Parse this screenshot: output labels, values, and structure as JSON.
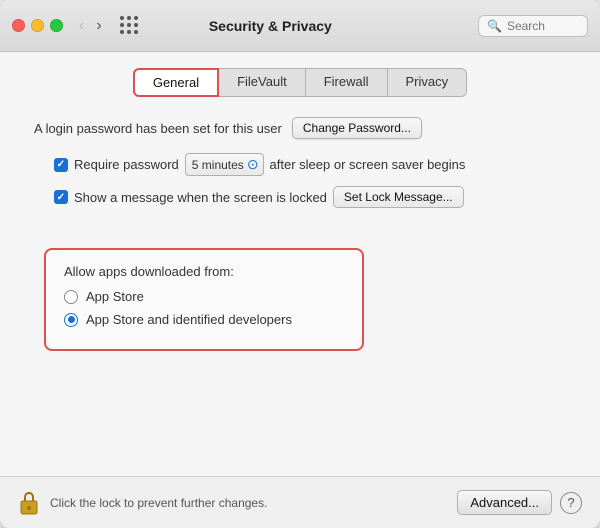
{
  "window": {
    "title": "Security & Privacy",
    "search_placeholder": "Search"
  },
  "titlebar": {
    "back_label": "‹",
    "forward_label": "›"
  },
  "tabs": [
    {
      "id": "general",
      "label": "General",
      "active": true
    },
    {
      "id": "filevault",
      "label": "FileVault",
      "active": false
    },
    {
      "id": "firewall",
      "label": "Firewall",
      "active": false
    },
    {
      "id": "privacy",
      "label": "Privacy",
      "active": false
    }
  ],
  "general": {
    "password_text": "A login password has been set for this user",
    "change_password_label": "Change Password...",
    "require_password_label": "Require password",
    "require_password_duration": "5 minutes",
    "after_sleep_label": "after sleep or screen saver begins",
    "show_message_label": "Show a message when the screen is locked",
    "set_lock_message_label": "Set Lock Message...",
    "allow_apps_title": "Allow apps downloaded from:",
    "app_store_label": "App Store",
    "app_store_identified_label": "App Store and identified developers"
  },
  "bottom_bar": {
    "lock_text": "Click the lock to prevent further changes.",
    "advanced_label": "Advanced...",
    "help_label": "?"
  }
}
